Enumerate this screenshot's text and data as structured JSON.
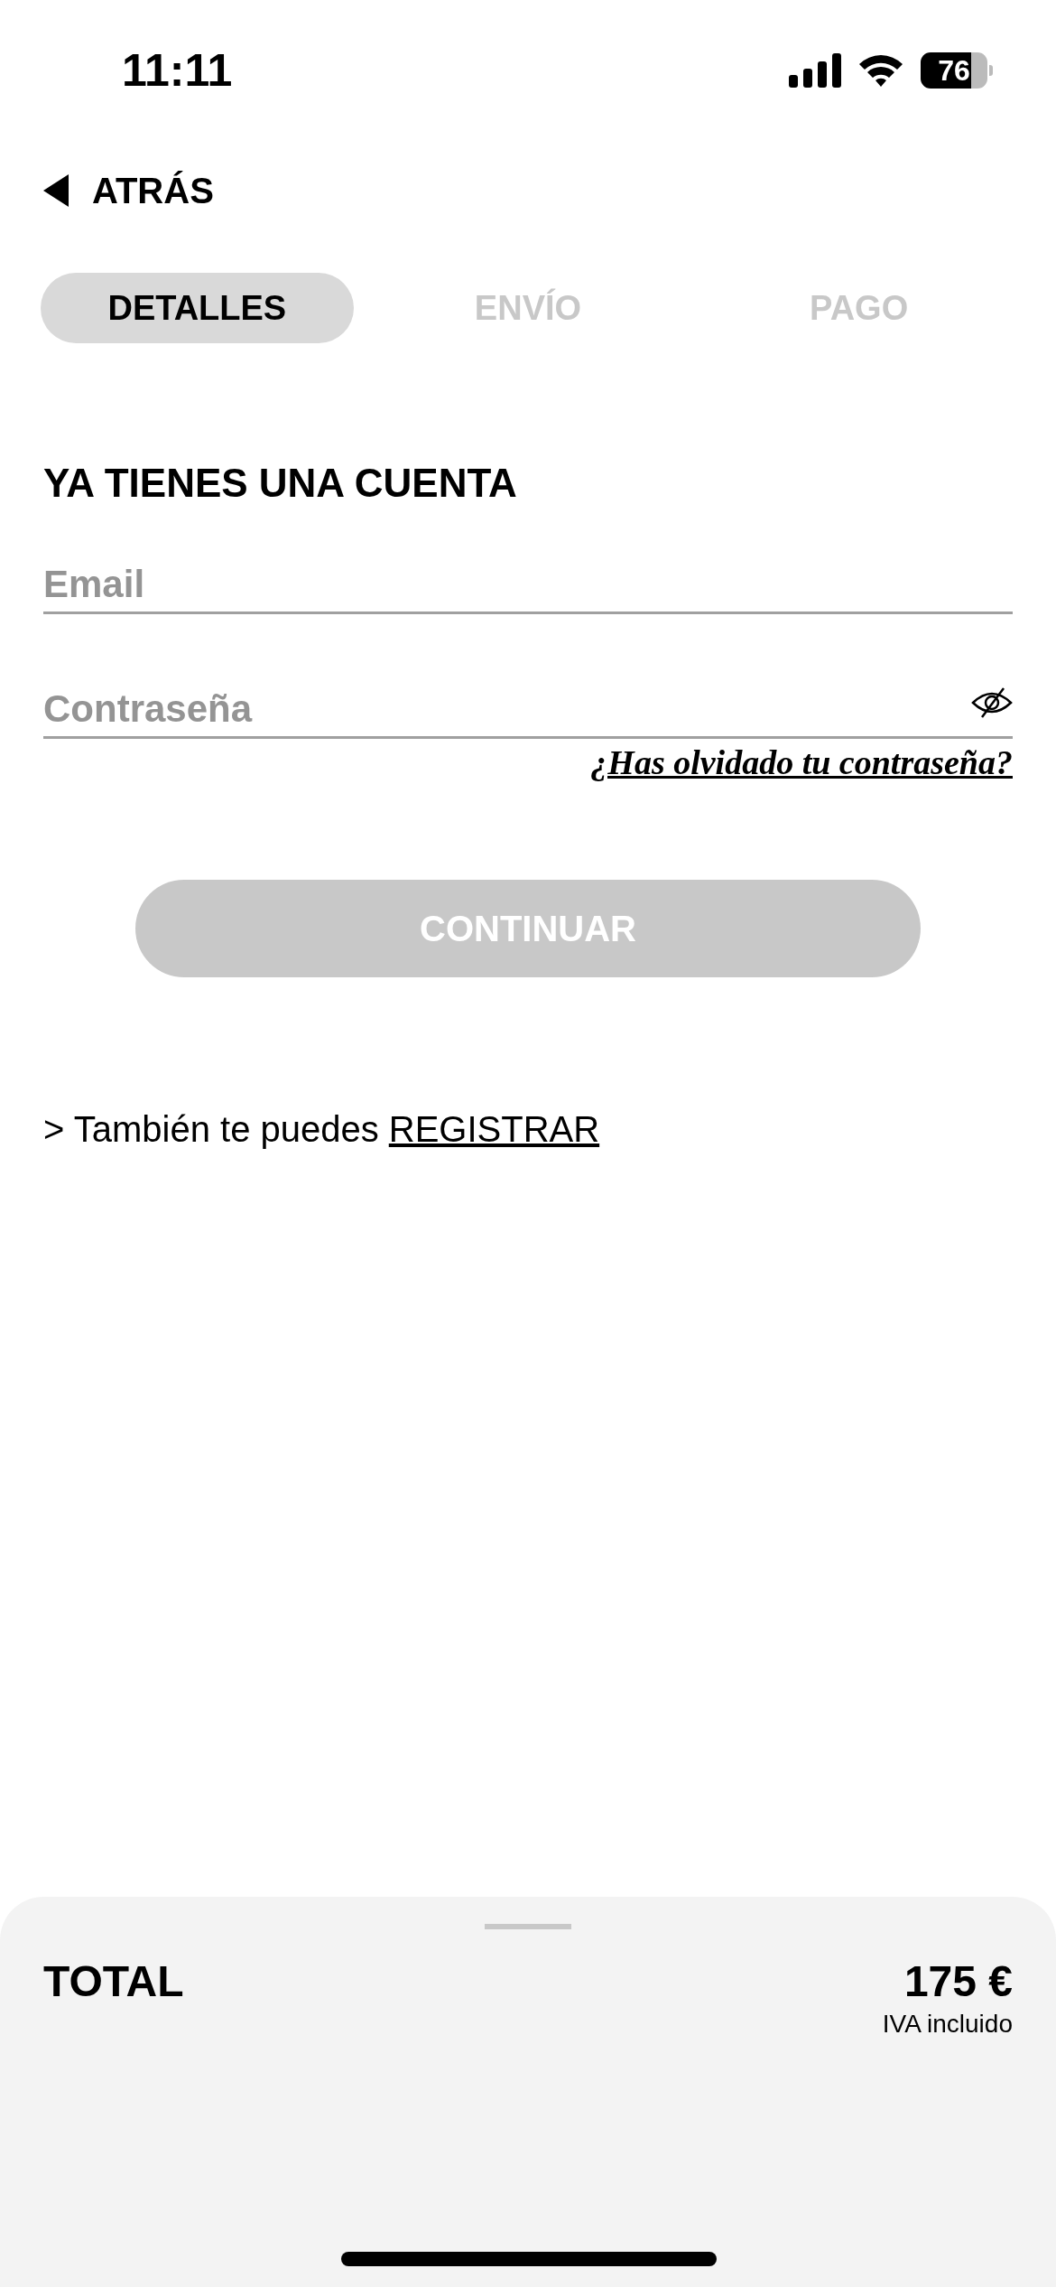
{
  "status_bar": {
    "time": "11:11",
    "battery": "76"
  },
  "back": {
    "label": "ATRÁS"
  },
  "tabs": [
    {
      "label": "DETALLES",
      "selected": true
    },
    {
      "label": "ENVÍO",
      "selected": false
    },
    {
      "label": "PAGO",
      "selected": false
    }
  ],
  "login": {
    "title": "YA TIENES UNA CUENTA",
    "email": {
      "placeholder": "Email"
    },
    "password": {
      "placeholder": "Contraseña"
    },
    "forgot_link": "¿Has olvidado tu contraseña?",
    "continue_button": {
      "label": "CONTINUAR",
      "disabled": true
    }
  },
  "register": {
    "prefix": "> También te puedes",
    "link": "REGISTRAR"
  },
  "summary": {
    "label": "TOTAL",
    "amount": "175 €",
    "note": "IVA incluido"
  }
}
